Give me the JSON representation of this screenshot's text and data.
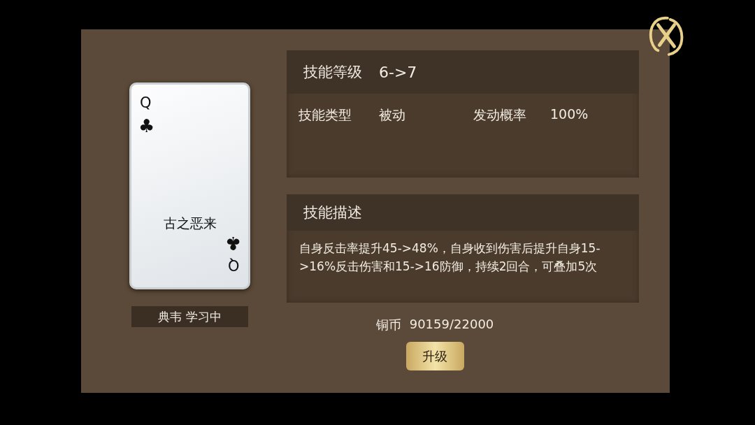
{
  "card": {
    "rank_top": "Q",
    "suit_top": "♣",
    "name": "古之恶来",
    "suit_bottom": "♣",
    "rank_bottom": "Q"
  },
  "learner_label": "典韦 学习中",
  "skill_panel": {
    "title": "技能等级",
    "level_change": "6->7",
    "type_label": "技能类型",
    "type_value": "被动",
    "chance_label": "发动概率",
    "chance_value": "100%"
  },
  "description_panel": {
    "title": "技能描述",
    "text": "自身反击率提升45->48%，自身收到伤害后提升自身15->16%反击伤害和15->16防御，持续2回合，可叠加5次"
  },
  "cost": {
    "label": "铜币",
    "value": "90159/22000"
  },
  "upgrade_button": "升级"
}
